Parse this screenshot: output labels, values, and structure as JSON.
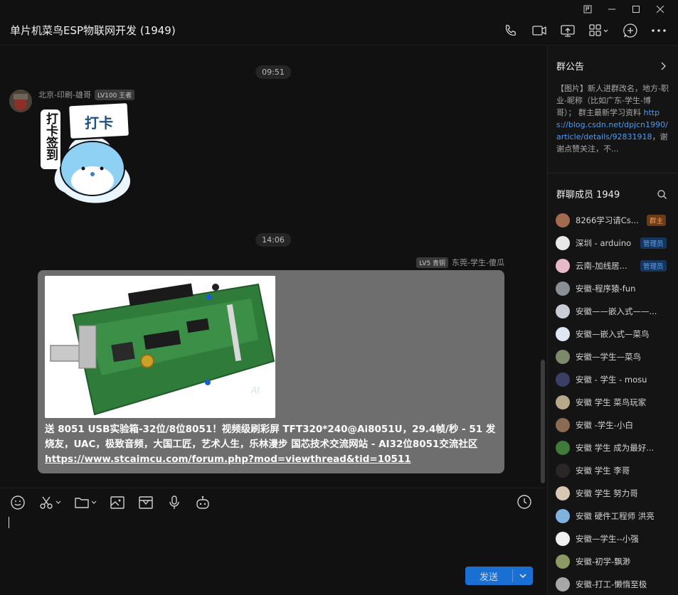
{
  "window": {
    "controls": [
      "pin-icon",
      "minimize-icon",
      "maximize-icon",
      "close-icon"
    ]
  },
  "header": {
    "title": "单片机菜鸟ESP物联网开发 (1949)",
    "tools": [
      "phone-icon",
      "video-icon",
      "screen-share-icon",
      "apps-icon",
      "add-member-icon",
      "more-icon"
    ]
  },
  "chat": {
    "messages": [
      {
        "time": "09:51",
        "sender": "北京-印刷-雄哥",
        "level": "LV100 王者",
        "sticker": {
          "side_text": "打卡签到",
          "sign_text": "打卡"
        }
      },
      {
        "time": "14:06",
        "sender": "东莞-学生-傻瓜",
        "level": "LV5 青铜",
        "text": "送 8051 USB实验箱-32位/8位8051！视频级刷彩屏 TFT320*240@Ai8051U，29.4帧/秒 - 51 发烧友，UAC，极致音频，大国工匠，艺术人生，乐林漫步 国芯技术交流网站 - AI32位8051交流社区 ",
        "link": "https://www.stcaimcu.com/forum.php?mod=viewthread&tid=10511",
        "board_label": "AI"
      }
    ]
  },
  "composer": {
    "tools": [
      "emoji-icon",
      "scissors-icon",
      "folder-icon",
      "image-icon",
      "mailbox-icon",
      "microphone-icon",
      "robot-icon"
    ],
    "send_label": "发送"
  },
  "sidebar": {
    "notice_title": "群公告",
    "notice_text": "【图片】新人进群改名，地方-职业-昵称（比如广东-学生-博哥）； 群主最新学习资料 ",
    "notice_link": "https://blog.csdn.net/dpjcn1990/article/details/92831918",
    "notice_tail": "，谢谢点赞关注，不...",
    "members_title": "群聊成员 1949",
    "members": [
      {
        "name": "8266学习请Cs...",
        "role": "群主",
        "color": "#a26b4f"
      },
      {
        "name": "深圳 - arduino",
        "role": "管理员",
        "color": "#e8e8e8"
      },
      {
        "name": "云南-加线居...",
        "role": "管理员",
        "color": "#e8b9c8"
      },
      {
        "name": "安徽-程序猿-fun",
        "role": "",
        "color": "#8a8f96"
      },
      {
        "name": "安徽——嵌入式——...",
        "role": "",
        "color": "#c8ccd6"
      },
      {
        "name": "安徽—嵌入式—菜鸟",
        "role": "",
        "color": "#dfe7f2"
      },
      {
        "name": "安徽—学生—菜鸟",
        "role": "",
        "color": "#7c8a6a"
      },
      {
        "name": "安徽 - 学生 - mosu",
        "role": "",
        "color": "#3b3f66"
      },
      {
        "name": "安徽 学生 菜鸟玩家",
        "role": "",
        "color": "#b8a88a"
      },
      {
        "name": "安徽 -学生-小白",
        "role": "",
        "color": "#8b6a52"
      },
      {
        "name": "安徽 学生 成为最好...",
        "role": "",
        "color": "#3f7a3a"
      },
      {
        "name": "安徽 学生 李哥",
        "role": "",
        "color": "#2a2626"
      },
      {
        "name": "安徽 学生 努力哥",
        "role": "",
        "color": "#d9c7b3"
      },
      {
        "name": "安徽 硬件工程师 洪亮",
        "role": "",
        "color": "#7fb2de"
      },
      {
        "name": "安徽—学生--小强",
        "role": "",
        "color": "#f0f0f0"
      },
      {
        "name": "安徽-初学-飘渺",
        "role": "",
        "color": "#8a9a62"
      },
      {
        "name": "安徽-打工-懒惰至极",
        "role": "",
        "color": "#a7a7a7"
      }
    ]
  }
}
